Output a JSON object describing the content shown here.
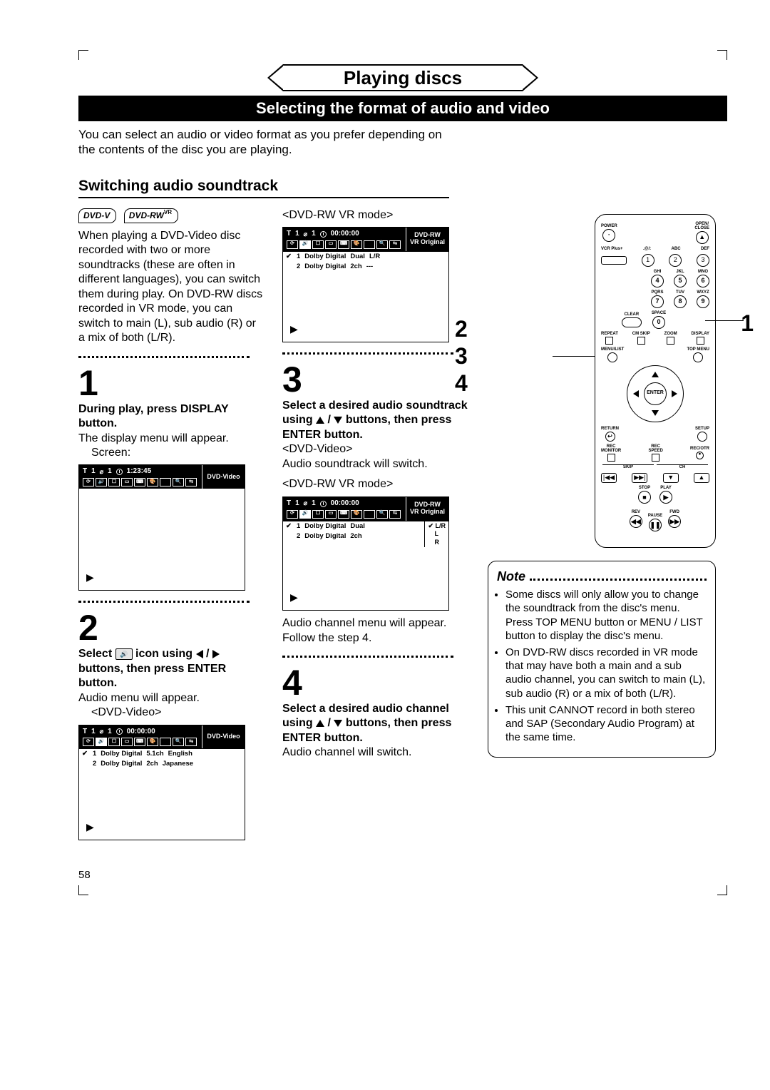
{
  "header": {
    "chapter": "Playing discs",
    "subhead": "Selecting the format of audio and video",
    "intro": "You can select an audio or video format as you prefer depending on the contents of the disc you are playing."
  },
  "section": {
    "title": "Switching audio soundtrack",
    "badges": {
      "dvdv": "DVD-V",
      "dvdrw": "DVD-RW",
      "vr": "VR"
    },
    "para": "When playing a DVD-Video disc recorded with two or more soundtracks (these are often in different languages), you can switch them during play. On DVD-RW discs recorded in VR mode, you can switch to main (L), sub audio (R) or a mix of both (L/R)."
  },
  "steps": {
    "s1": {
      "num": "1",
      "title": "During play, press DISPLAY button.",
      "body": "The display menu will appear.",
      "screen_label": "Screen:"
    },
    "s2": {
      "num": "2",
      "title_pre": "Select ",
      "title_mid": " icon using ",
      "title_buttons": " / ",
      "title_post": " buttons, then press ENTER button.",
      "body": "Audio menu will appear.",
      "mode_dvdv": "<DVD-Video>"
    },
    "s3": {
      "num": "3",
      "mode_vr_top": "<DVD-RW VR mode>",
      "title_pre": "Select a desired audio soundtrack using ",
      "title_post": " buttons, then press ENTER button.",
      "mode_dvdv": "<DVD-Video>",
      "body_dvdv": "Audio soundtrack will switch.",
      "mode_vr": "<DVD-RW VR mode>",
      "body_vr1": "Audio channel menu will appear.",
      "body_vr2": "Follow the step 4."
    },
    "s4": {
      "num": "4",
      "title_pre": "Select a desired audio channel using ",
      "title_post": " buttons, then press ENTER button.",
      "body": "Audio channel will switch."
    }
  },
  "osd": {
    "T": "T",
    "one": "1",
    "disc": "⌀",
    "time1": "1:23:45",
    "time2": "00:00:00",
    "type_dvdv": "DVD-Video",
    "type_vr": "DVD-RW\nVR Original",
    "play": "▶",
    "audio_dvdv": {
      "r1": {
        "chk": "✔",
        "n": "1",
        "codec": "Dolby Digital",
        "ch": "5.1ch",
        "lang": "English"
      },
      "r2": {
        "chk": "",
        "n": "2",
        "codec": "Dolby Digital",
        "ch": "2ch",
        "lang": "Japanese"
      }
    },
    "audio_vr1": {
      "r1": {
        "chk": "✔",
        "n": "1",
        "codec": "Dolby Digital",
        "ch": "Dual",
        "mix": "L/R"
      },
      "r2": {
        "chk": "",
        "n": "2",
        "codec": "Dolby Digital",
        "ch": "2ch",
        "mix": "---"
      }
    },
    "audio_vr2": {
      "r1": {
        "chk": "✔",
        "n": "1",
        "codec": "Dolby Digital",
        "ch": "Dual"
      },
      "r2": {
        "chk": "",
        "n": "2",
        "codec": "Dolby Digital",
        "ch": "2ch"
      },
      "opts": {
        "sel": "✔ L/R",
        "o2": "L",
        "o3": "R"
      }
    }
  },
  "remote": {
    "power": "POWER",
    "open": "OPEN/\nCLOSE",
    "eject": "▲",
    "vcrplus": "VCR Plus+",
    "atmarks": ".@/:",
    "abc": "ABC",
    "def": "DEF",
    "n1": "1",
    "n2": "2",
    "n3": "3",
    "ghi": "GHI",
    "jkl": "JKL",
    "mno": "MNO",
    "n4": "4",
    "n5": "5",
    "n6": "6",
    "pqrs": "PQRS",
    "tuv": "TUV",
    "wxyz": "WXYZ",
    "n7": "7",
    "n8": "8",
    "n9": "9",
    "clear": "CLEAR",
    "space": "SPACE",
    "n0": "0",
    "repeat": "REPEAT",
    "cmskip": "CM SKIP",
    "zoom": "ZOOM",
    "display": "DISPLAY",
    "menulist": "MENU/LIST",
    "topmenu": "TOP MENU",
    "enter": "ENTER",
    "return": "RETURN",
    "setup": "SETUP",
    "recmon": "REC\nMONITOR",
    "recspd": "REC\nSPEED",
    "recotr": "REC/OTR",
    "skip": "SKIP",
    "ch": "CH",
    "stop": "STOP",
    "play": "PLAY",
    "rev": "REV",
    "fwd": "FWD",
    "pause": "PAUSE",
    "stop_sym": "■",
    "play_sym": "▶",
    "rev_sym": "◀◀",
    "fwd_sym": "▶▶",
    "pause_sym": "❚❚",
    "skipL": "|◀◀",
    "skipR": "▶▶|",
    "chUp": "▲",
    "chDn": "▼",
    "rec": "●"
  },
  "callouts": {
    "c1": "1",
    "c2": "2",
    "c3": "3",
    "c4": "4"
  },
  "note": {
    "title": "Note",
    "b1": "Some discs will only allow you to change the soundtrack from the disc's menu. Press TOP MENU button or MENU / LIST button to display the disc's menu.",
    "b2": "On DVD-RW discs recorded in VR mode that may have both a main and a sub audio channel, you can switch to main (L), sub audio (R) or a mix of both (L/R).",
    "b3": "This unit CANNOT record in both stereo and SAP (Secondary Audio Program) at the same time."
  },
  "page": {
    "num": "58"
  }
}
